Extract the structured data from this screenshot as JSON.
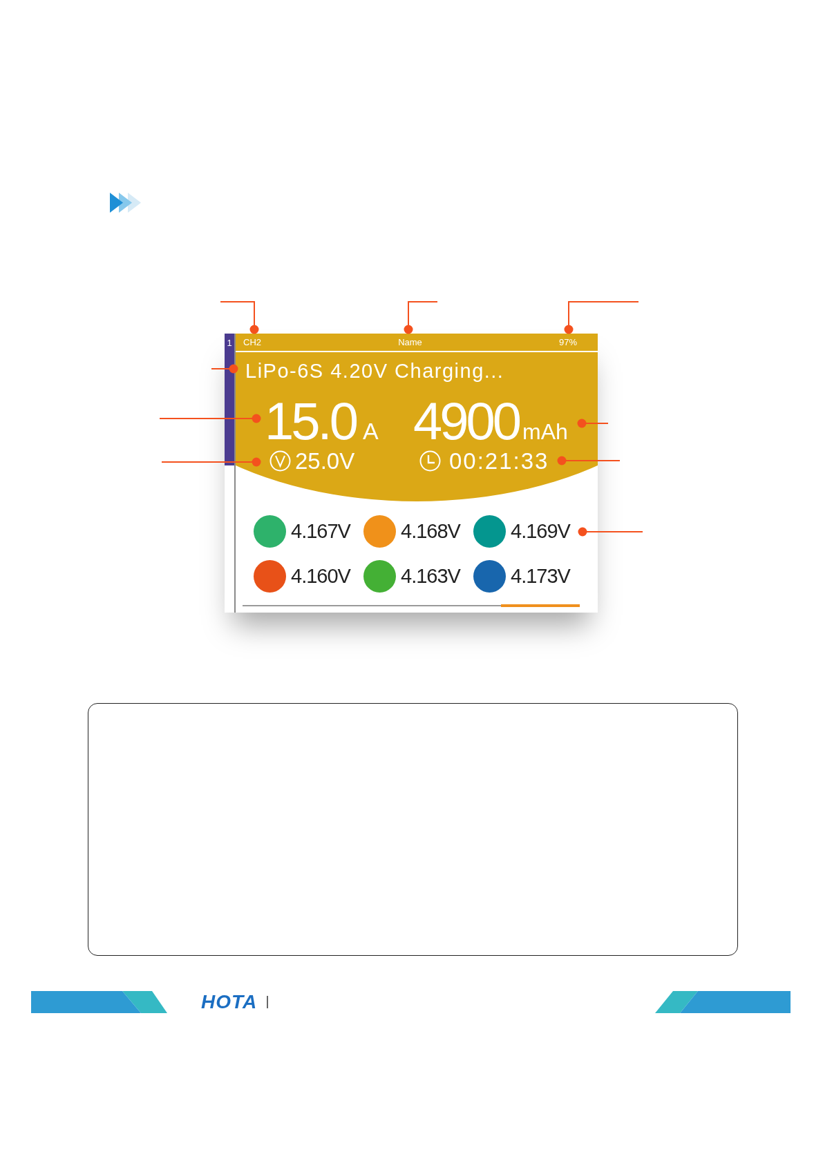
{
  "screen": {
    "slot": "1",
    "header": {
      "channel": "CH2",
      "name": "Name",
      "percent": "97%"
    },
    "status": "LiPo-6S 4.20V Charging...",
    "current": {
      "value": "15.0",
      "unit": "A"
    },
    "capacity": {
      "value": "4900",
      "unit": "mAh"
    },
    "voltage": "25.0V",
    "elapsed": "00:21:33",
    "cells": [
      {
        "voltage": "4.167V",
        "color": "#2eb26b"
      },
      {
        "voltage": "4.168V",
        "color": "#f0911a"
      },
      {
        "voltage": "4.169V",
        "color": "#04968f"
      },
      {
        "voltage": "4.160V",
        "color": "#e85118"
      },
      {
        "voltage": "4.163V",
        "color": "#44b035"
      },
      {
        "voltage": "4.173V",
        "color": "#1866ad"
      }
    ]
  },
  "footer": {
    "logo": "HOTA"
  }
}
